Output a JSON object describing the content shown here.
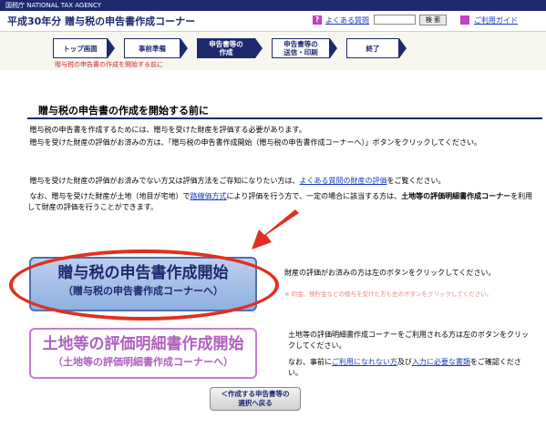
{
  "agency": "国税庁 NATIONAL TAX AGENCY",
  "header": {
    "title": "平成30年分 贈与税の申告書作成コーナー",
    "faq_label": "よくある質問",
    "search_button": "検 索",
    "guide_label": "ご利用ガイド"
  },
  "steps": [
    {
      "label": "トップ画面"
    },
    {
      "label": "事前準備"
    },
    {
      "label": "申告書等の\n作成",
      "active": true
    },
    {
      "label": "申告書等の\n送信・印刷"
    },
    {
      "label": "終了"
    }
  ],
  "step_note": "贈与税の申告書の作成を開始する前に",
  "section_title": "贈与税の申告書の作成を開始する前に",
  "paragraphs": {
    "p1": "贈与税の申告書を作成するためには、贈与を受けた財産を評価する必要があります。",
    "p2": "贈与を受けた財産の評価がお済みの方は、「贈与税の申告書作成開始（贈与税の申告書作成コーナーへ）」ボタンをクリックしてください。",
    "p3_before": "贈与を受けた財産の評価がお済みでない方又は評価方法をご存知になりたい方は、",
    "p3_link": "よくある質問の財産の評価",
    "p3_after": "をご覧ください。",
    "p4_before": "なお、贈与を受けた財産が土地（地目が宅地）で",
    "p4_link": "路線価方式",
    "p4_mid": "により評価を行う方で、一定の場合に該当する方は、",
    "p4_bold": "土地等の評価明細書作成コーナー",
    "p4_after": "を利用して財産の評価を行うことができます。"
  },
  "buttons": {
    "start_main": "贈与税の申告書作成開始",
    "start_sub": "（贈与税の申告書作成コーナーへ）",
    "land_main": "土地等の評価明細書作成開始",
    "land_sub": "（土地等の評価明細書作成コーナーへ）",
    "back_line1": "＜作成する申告書等の",
    "back_line2": "選択へ戻る"
  },
  "side": {
    "start_desc": "財産の評価がお済みの方は左のボタンをクリックしてください。",
    "faint_note": "※ 同金、預貯金などの贈与を受けた方も左のボタンをクリックしてください。",
    "land_desc": "土地等の評価明細書作成コーナーをご利用される方は左のボタンをクリックしてください。",
    "note_before": "なお、事前に",
    "note_link1": "ご利用になれない方",
    "note_mid": "及び",
    "note_link2": "入力に必要な書類",
    "note_after": "をご確認ください。"
  },
  "colors": {
    "navy": "#1e2a6e",
    "highlight": "#e03020",
    "purple": "#b060c0"
  }
}
